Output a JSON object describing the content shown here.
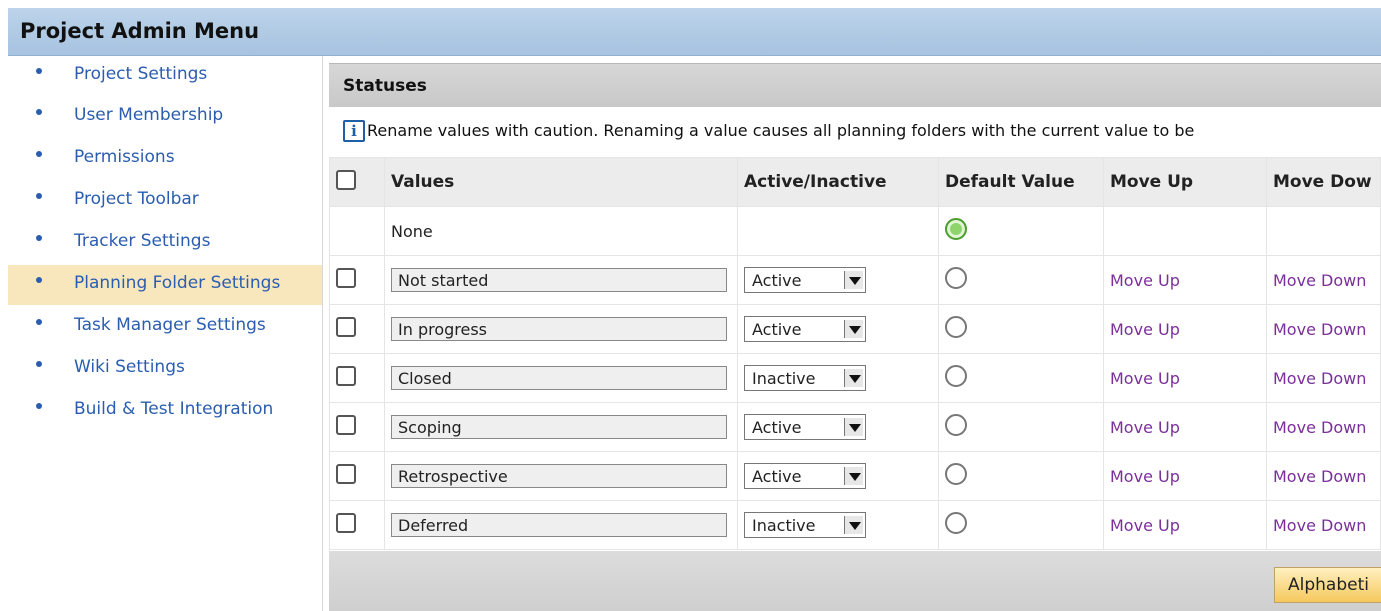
{
  "header": {
    "title": "Project Admin Menu"
  },
  "sidebar": {
    "items": [
      {
        "label": "Project Settings"
      },
      {
        "label": "User Membership"
      },
      {
        "label": "Permissions"
      },
      {
        "label": "Project Toolbar"
      },
      {
        "label": "Tracker Settings"
      },
      {
        "label": "Planning Folder Settings",
        "selected": true
      },
      {
        "label": "Task Manager Settings"
      },
      {
        "label": "Wiki Settings"
      },
      {
        "label": "Build & Test Integration"
      }
    ]
  },
  "panel": {
    "title": "Statuses",
    "info_text": "Rename values with caution. Renaming a value causes all planning folders with the current value to be",
    "info_icon": "info-icon",
    "columns": {
      "values": "Values",
      "active": "Active/Inactive",
      "default": "Default Value",
      "move_up": "Move Up",
      "move_down": "Move Dow"
    },
    "rows": [
      {
        "value": "None"
      },
      {
        "value": "Not started",
        "status": "Active",
        "move_up": "Move Up",
        "move_down": "Move Down"
      },
      {
        "value": "In progress",
        "status": "Active",
        "move_up": "Move Up",
        "move_down": "Move Down"
      },
      {
        "value": "Closed",
        "status": "Inactive",
        "move_up": "Move Up",
        "move_down": "Move Down"
      },
      {
        "value": "Scoping",
        "status": "Active",
        "move_up": "Move Up",
        "move_down": "Move Down"
      },
      {
        "value": "Retrospective",
        "status": "Active",
        "move_up": "Move Up",
        "move_down": "Move Down"
      },
      {
        "value": "Deferred",
        "status": "Inactive",
        "move_up": "Move Up",
        "move_down": "Move Down"
      }
    ],
    "button": "Alphabeti"
  }
}
